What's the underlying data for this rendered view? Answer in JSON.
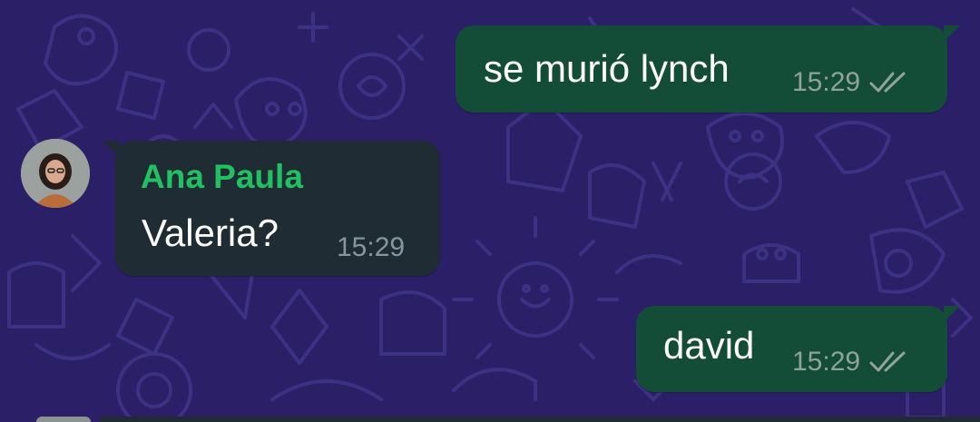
{
  "chat": {
    "messages": [
      {
        "direction": "outgoing",
        "text": "se murió lynch",
        "time": "15:29",
        "status_icon": "double-check-icon"
      },
      {
        "direction": "incoming",
        "sender": "Ana Paula",
        "text": "Valeria?",
        "time": "15:29",
        "avatar_icon": "contact-avatar"
      },
      {
        "direction": "outgoing",
        "text": "david",
        "time": "15:29",
        "status_icon": "double-check-icon"
      }
    ]
  },
  "colors": {
    "background": "#2b1f68",
    "wallpaper_pattern": "#3a2e7a",
    "outgoing_bubble": "#144d37",
    "incoming_bubble": "#202c33",
    "sender_name": "#21c063",
    "message_text": "#ffffff",
    "timestamp": "#8fa39a"
  }
}
